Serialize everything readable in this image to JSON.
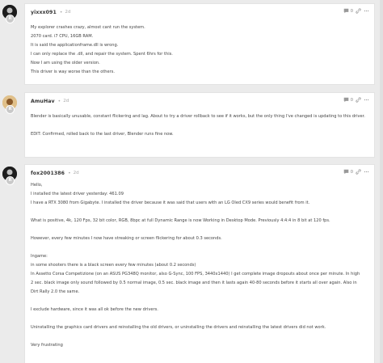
{
  "posts": [
    {
      "username": "yixxx091",
      "time": "2d",
      "comment_count": "0",
      "paragraphs": [
        "My explorer crashes crazy, almost cant run the system.",
        "2070 card. i7 CPU, 16GB RAM.",
        "It is said the applicationframe.dll is wrong.",
        "I can only replace the .dll, and repair the system. Spent 6hrs for this.",
        "Now I am using the older version.",
        "This driver is way worse than the others."
      ]
    },
    {
      "username": "AmuHav",
      "time": "2d",
      "comment_count": "0",
      "paragraphs": [
        "Blender is basically unusable, constant flickering and lag. About to try a driver rollback to see if it works, but the only thing I've changed is updating to this driver.",
        "",
        "EDIT: Confirmed, rolled back to the last driver, Blender runs fine now."
      ]
    },
    {
      "username": "fox2001386",
      "time": "2d",
      "comment_count": "0",
      "paragraphs": [
        "Hello,",
        "I installed the latest driver yesterday: 461.09",
        "I have a RTX 3080 from Gigabyte. I installed the driver because it was said that users with an LG Oled CX9 series would benefit from it.",
        "",
        "What is positive, 4k, 120 Fps, 32 bit color, RGB, 8bpc at full Dynamic Range is now Working in Desktop Mode. Previously 4:4:4 in 8 bit at 120 fps.",
        "",
        "However, every few minutes I now have streaking or screen flickering for about 0.3 seconds.",
        "",
        "Ingame:",
        "in some shooters there is a black screen every few minutes (about 0.2 seconds)",
        "In Assetto Corsa Competizione (on an ASUS PG348Q monitor, also G-Sync, 100 FPS, 3440x1440) I get complete image dropouts about once per minute. In high",
        "2 sec. black image only sound followed by 0.5 normal image, 0.5 sec. black image and then it lasts again 40-80 seconds before it starts all over again. Also in",
        "Dirt Rally 2.0 the same.",
        "",
        "I exclude hardware, since it was all ok before the new drivers.",
        "",
        "Uninstalling the graphics card drivers and reinstalling the old drivers, or uninstalling the drivers and reinstalling the latest drivers did not work.",
        "",
        "Very frustrating"
      ]
    }
  ]
}
